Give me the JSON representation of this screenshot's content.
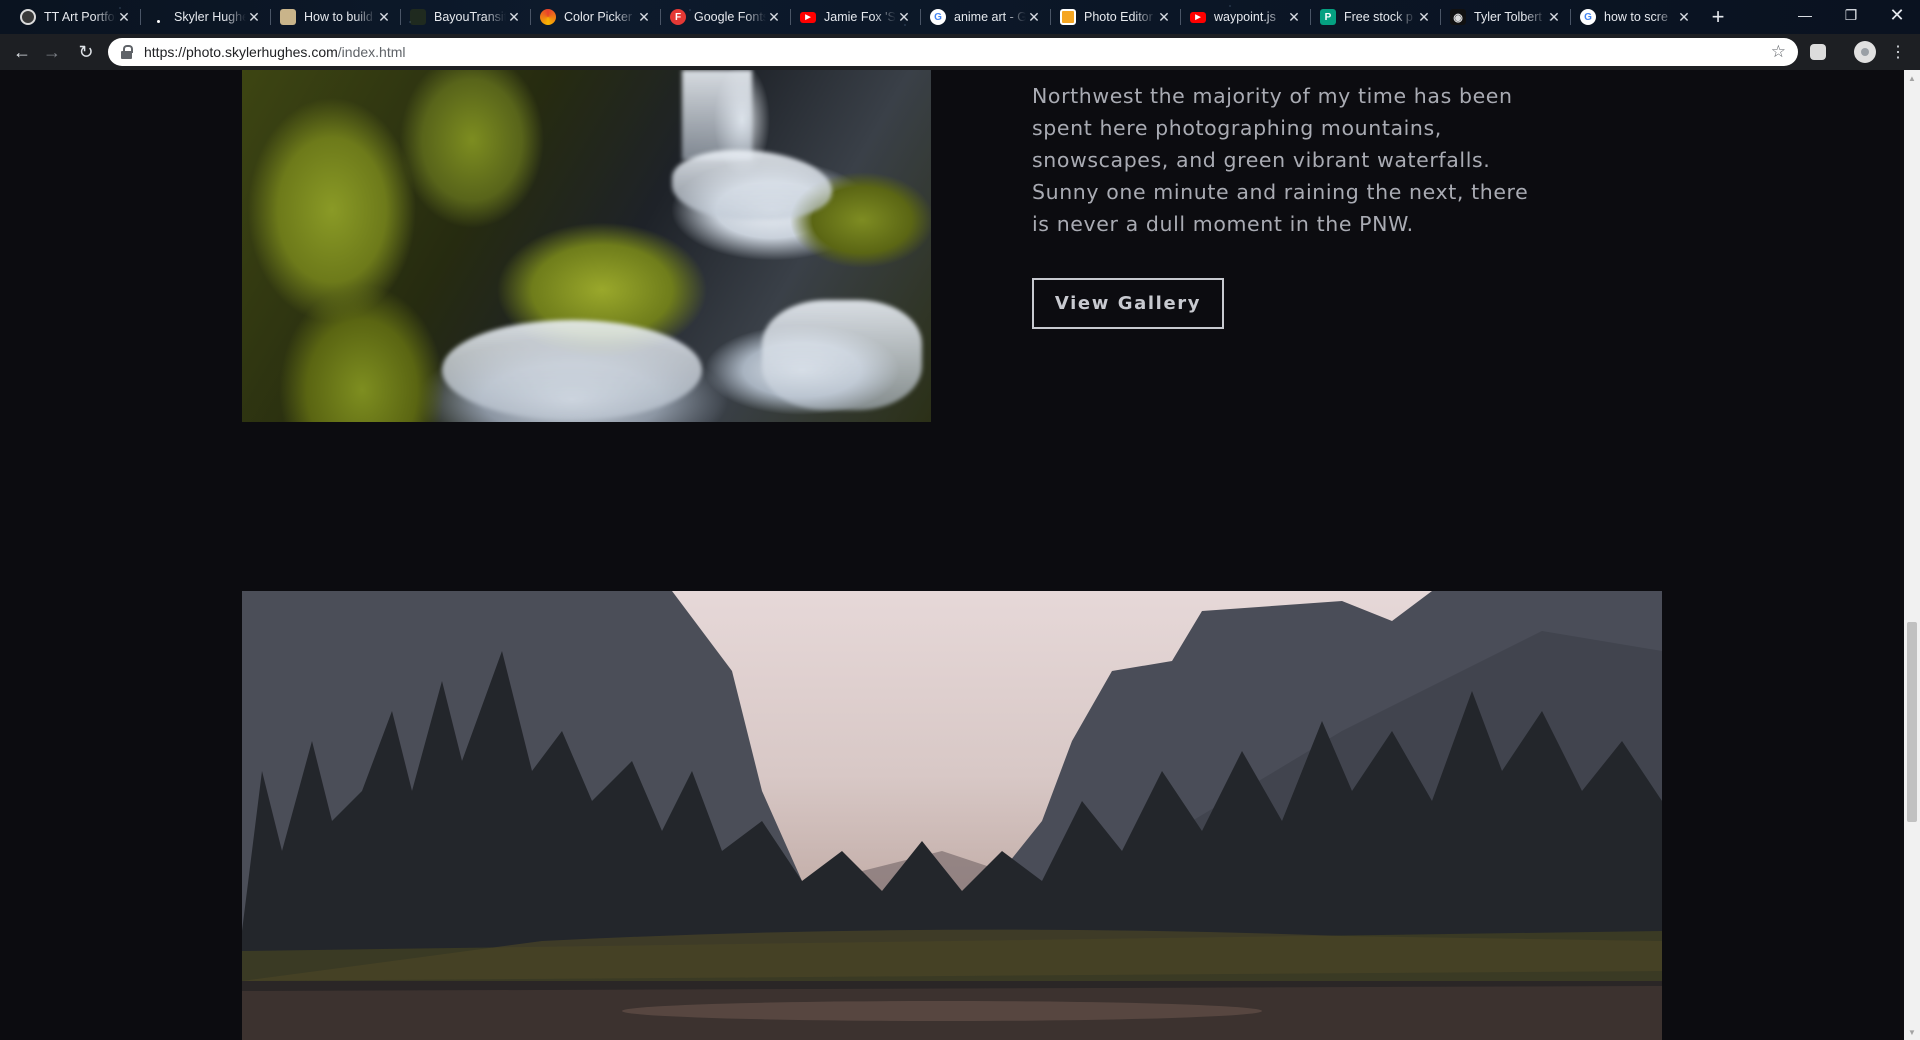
{
  "browser": {
    "tabs": [
      {
        "title": "TT Art Portfolio",
        "icon": "globe-icon",
        "color": "#3a3a3a"
      },
      {
        "title": "Skyler Hughes",
        "icon": "dot-icon",
        "color": "#000000"
      },
      {
        "title": "How to build",
        "icon": "page-icon",
        "color": "#c9b48a"
      },
      {
        "title": "BayouTransit",
        "icon": "leaf-icon",
        "color": "#1f2a1f"
      },
      {
        "title": "Color Picker",
        "icon": "color-wheel-icon",
        "color": "#e8412b"
      },
      {
        "title": "Google Fonts",
        "icon": "google-fonts-icon",
        "color": "#e53935",
        "glyph": "F"
      },
      {
        "title": "Jamie Fox 'St",
        "icon": "youtube-icon",
        "color": "#ff0000"
      },
      {
        "title": "anime art - G",
        "icon": "google-icon",
        "color": "#ffffff",
        "glyph": "G"
      },
      {
        "title": "Photo Editor",
        "icon": "photo-editor-icon",
        "color": "#f5a623"
      },
      {
        "title": "waypoint.js",
        "icon": "youtube-icon",
        "color": "#ff0000"
      },
      {
        "title": "Free stock p",
        "icon": "pexels-icon",
        "color": "#05a081",
        "glyph": "P"
      },
      {
        "title": "Tyler Tolbert",
        "icon": "mask-icon",
        "color": "#111111"
      },
      {
        "title": "how to scre",
        "icon": "google-icon",
        "color": "#ffffff",
        "glyph": "G"
      }
    ],
    "url_host": "https://photo.skylerhughes.com",
    "url_path": "/index.html"
  },
  "section": {
    "description": "Northwest the majority of my time has been spent here photographing mountains, snowscapes, and green vibrant waterfalls. Sunny one minute and raining the next, there is never a dull moment in the PNW.",
    "button_label": "View Gallery"
  },
  "images": {
    "waterfall": "mossy-waterfall-photo",
    "valley": "yosemite-valley-photo"
  }
}
